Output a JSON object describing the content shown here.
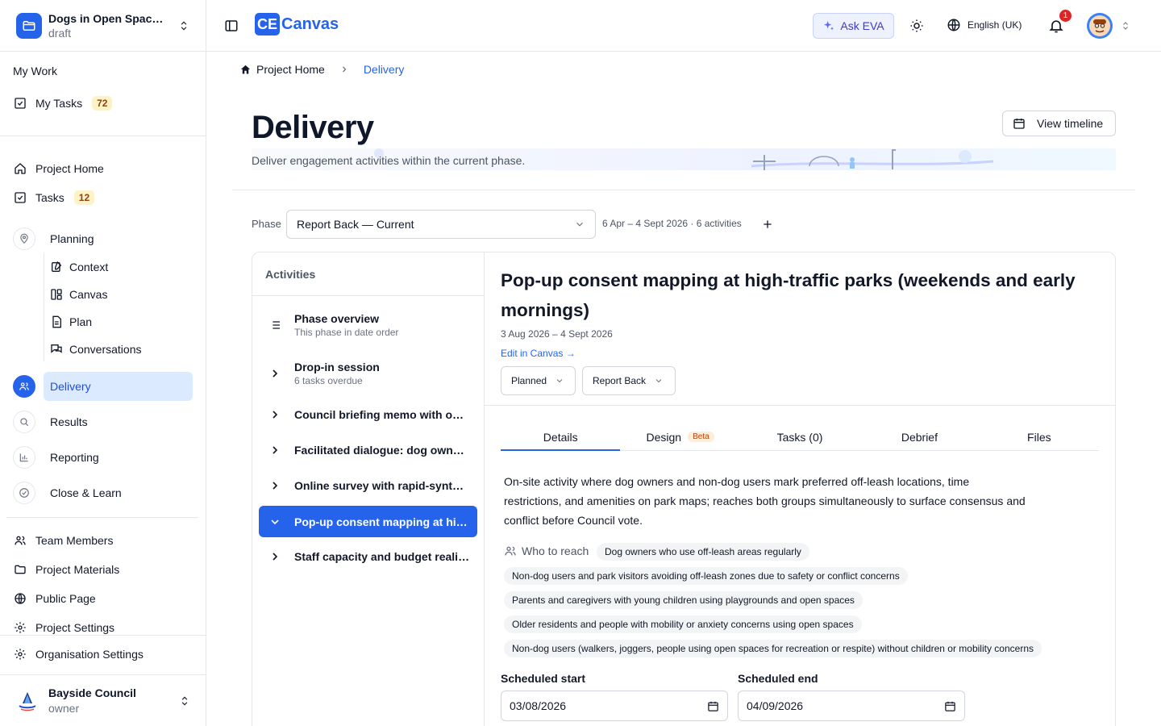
{
  "project": {
    "name": "Dogs in Open Space Management",
    "status": "draft"
  },
  "sidebar": {
    "my_work_label": "My Work",
    "my_tasks_label": "My Tasks",
    "my_tasks_count": "72",
    "project_home_label": "Project Home",
    "tasks_label": "Tasks",
    "tasks_count": "12",
    "planning_label": "Planning",
    "planning_sub": [
      "Context",
      "Canvas",
      "Plan",
      "Conversations"
    ],
    "delivery_label": "Delivery",
    "results_label": "Results",
    "reporting_label": "Reporting",
    "close_label": "Close & Learn",
    "team_label": "Team Members",
    "materials_label": "Project Materials",
    "public_label": "Public Page",
    "proj_settings_label": "Project Settings",
    "org_settings_label": "Organisation Settings"
  },
  "org": {
    "name": "Bayside Council",
    "role": "owner"
  },
  "topbar": {
    "logo_badge": "CE",
    "logo_text": "Canvas",
    "ask_eva": "Ask EVA",
    "language": "English (UK)",
    "notif_count": "1"
  },
  "breadcrumb": {
    "home": "Project Home",
    "current": "Delivery"
  },
  "page": {
    "title": "Delivery",
    "subtitle": "Deliver engagement activities within the current phase.",
    "view_timeline": "View timeline"
  },
  "phase": {
    "label": "Phase",
    "selected": "Report Back — Current",
    "meta": "6 Apr – 4 Sept 2026 · 6 activities"
  },
  "activities": {
    "header": "Activities",
    "overview_title": "Phase overview",
    "overview_sub": "This phase in date order",
    "items": [
      {
        "title": "Drop-in session",
        "sub": "6 tasks overdue"
      },
      {
        "title": "Council briefing memo with options analysis",
        "sub": ""
      },
      {
        "title": "Facilitated dialogue: dog owners and park users",
        "sub": ""
      },
      {
        "title": "Online survey with rapid-synthesis report",
        "sub": ""
      },
      {
        "title": "Pop-up consent mapping at high-traffic parks",
        "sub": ""
      },
      {
        "title": "Staff capacity and budget reality check",
        "sub": ""
      }
    ]
  },
  "detail": {
    "title": "Pop-up consent mapping at high-traffic parks (weekends and early mornings)",
    "dates": "3 Aug 2026 – 4 Sept 2026",
    "edit_link": "Edit in Canvas →",
    "status": "Planned",
    "phase": "Report Back",
    "tabs": [
      "Details",
      "Design",
      "Tasks (0)",
      "Debrief",
      "Files"
    ],
    "beta_label": "Beta",
    "description": "On-site activity where dog owners and non-dog users mark preferred off-leash locations, time restrictions, and amenities on park maps; reaches both groups simultaneously to surface consensus and conflict before Council vote.",
    "who_label": "Who to reach",
    "audiences": [
      "Dog owners who use off-leash areas regularly",
      "Non-dog users and park visitors avoiding off-leash zones due to safety or conflict concerns",
      "Parents and caregivers with young children using playgrounds and open spaces",
      "Older residents and people with mobility or anxiety concerns using open spaces",
      "Non-dog users (walkers, joggers, people using open spaces for recreation or respite) without children or mobility concerns"
    ],
    "start_label": "Scheduled start",
    "start_value": "03/08/2026",
    "end_label": "Scheduled end",
    "end_value": "04/09/2026"
  },
  "colors": {
    "accent": "#2563eb",
    "badge_bg": "#fef3c7",
    "notif": "#dc2626"
  }
}
